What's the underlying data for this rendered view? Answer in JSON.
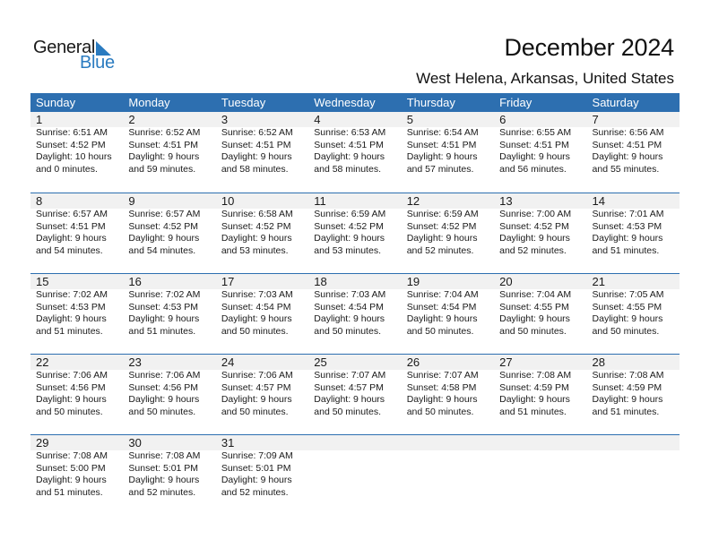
{
  "logo": {
    "word1": "General",
    "word2": "Blue",
    "accent": "#2a7bc0"
  },
  "header": {
    "title": "December 2024",
    "location": "West Helena, Arkansas, United States"
  },
  "colors": {
    "header_bg": "#2d6fb0",
    "strip_bg": "#f1f1f1"
  },
  "weekdays": [
    "Sunday",
    "Monday",
    "Tuesday",
    "Wednesday",
    "Thursday",
    "Friday",
    "Saturday"
  ],
  "weeks": [
    [
      {
        "day": "1",
        "sunrise": "Sunrise: 6:51 AM",
        "sunset": "Sunset: 4:52 PM",
        "daylight1": "Daylight: 10 hours",
        "daylight2": "and 0 minutes."
      },
      {
        "day": "2",
        "sunrise": "Sunrise: 6:52 AM",
        "sunset": "Sunset: 4:51 PM",
        "daylight1": "Daylight: 9 hours",
        "daylight2": "and 59 minutes."
      },
      {
        "day": "3",
        "sunrise": "Sunrise: 6:52 AM",
        "sunset": "Sunset: 4:51 PM",
        "daylight1": "Daylight: 9 hours",
        "daylight2": "and 58 minutes."
      },
      {
        "day": "4",
        "sunrise": "Sunrise: 6:53 AM",
        "sunset": "Sunset: 4:51 PM",
        "daylight1": "Daylight: 9 hours",
        "daylight2": "and 58 minutes."
      },
      {
        "day": "5",
        "sunrise": "Sunrise: 6:54 AM",
        "sunset": "Sunset: 4:51 PM",
        "daylight1": "Daylight: 9 hours",
        "daylight2": "and 57 minutes."
      },
      {
        "day": "6",
        "sunrise": "Sunrise: 6:55 AM",
        "sunset": "Sunset: 4:51 PM",
        "daylight1": "Daylight: 9 hours",
        "daylight2": "and 56 minutes."
      },
      {
        "day": "7",
        "sunrise": "Sunrise: 6:56 AM",
        "sunset": "Sunset: 4:51 PM",
        "daylight1": "Daylight: 9 hours",
        "daylight2": "and 55 minutes."
      }
    ],
    [
      {
        "day": "8",
        "sunrise": "Sunrise: 6:57 AM",
        "sunset": "Sunset: 4:51 PM",
        "daylight1": "Daylight: 9 hours",
        "daylight2": "and 54 minutes."
      },
      {
        "day": "9",
        "sunrise": "Sunrise: 6:57 AM",
        "sunset": "Sunset: 4:52 PM",
        "daylight1": "Daylight: 9 hours",
        "daylight2": "and 54 minutes."
      },
      {
        "day": "10",
        "sunrise": "Sunrise: 6:58 AM",
        "sunset": "Sunset: 4:52 PM",
        "daylight1": "Daylight: 9 hours",
        "daylight2": "and 53 minutes."
      },
      {
        "day": "11",
        "sunrise": "Sunrise: 6:59 AM",
        "sunset": "Sunset: 4:52 PM",
        "daylight1": "Daylight: 9 hours",
        "daylight2": "and 53 minutes."
      },
      {
        "day": "12",
        "sunrise": "Sunrise: 6:59 AM",
        "sunset": "Sunset: 4:52 PM",
        "daylight1": "Daylight: 9 hours",
        "daylight2": "and 52 minutes."
      },
      {
        "day": "13",
        "sunrise": "Sunrise: 7:00 AM",
        "sunset": "Sunset: 4:52 PM",
        "daylight1": "Daylight: 9 hours",
        "daylight2": "and 52 minutes."
      },
      {
        "day": "14",
        "sunrise": "Sunrise: 7:01 AM",
        "sunset": "Sunset: 4:53 PM",
        "daylight1": "Daylight: 9 hours",
        "daylight2": "and 51 minutes."
      }
    ],
    [
      {
        "day": "15",
        "sunrise": "Sunrise: 7:02 AM",
        "sunset": "Sunset: 4:53 PM",
        "daylight1": "Daylight: 9 hours",
        "daylight2": "and 51 minutes."
      },
      {
        "day": "16",
        "sunrise": "Sunrise: 7:02 AM",
        "sunset": "Sunset: 4:53 PM",
        "daylight1": "Daylight: 9 hours",
        "daylight2": "and 51 minutes."
      },
      {
        "day": "17",
        "sunrise": "Sunrise: 7:03 AM",
        "sunset": "Sunset: 4:54 PM",
        "daylight1": "Daylight: 9 hours",
        "daylight2": "and 50 minutes."
      },
      {
        "day": "18",
        "sunrise": "Sunrise: 7:03 AM",
        "sunset": "Sunset: 4:54 PM",
        "daylight1": "Daylight: 9 hours",
        "daylight2": "and 50 minutes."
      },
      {
        "day": "19",
        "sunrise": "Sunrise: 7:04 AM",
        "sunset": "Sunset: 4:54 PM",
        "daylight1": "Daylight: 9 hours",
        "daylight2": "and 50 minutes."
      },
      {
        "day": "20",
        "sunrise": "Sunrise: 7:04 AM",
        "sunset": "Sunset: 4:55 PM",
        "daylight1": "Daylight: 9 hours",
        "daylight2": "and 50 minutes."
      },
      {
        "day": "21",
        "sunrise": "Sunrise: 7:05 AM",
        "sunset": "Sunset: 4:55 PM",
        "daylight1": "Daylight: 9 hours",
        "daylight2": "and 50 minutes."
      }
    ],
    [
      {
        "day": "22",
        "sunrise": "Sunrise: 7:06 AM",
        "sunset": "Sunset: 4:56 PM",
        "daylight1": "Daylight: 9 hours",
        "daylight2": "and 50 minutes."
      },
      {
        "day": "23",
        "sunrise": "Sunrise: 7:06 AM",
        "sunset": "Sunset: 4:56 PM",
        "daylight1": "Daylight: 9 hours",
        "daylight2": "and 50 minutes."
      },
      {
        "day": "24",
        "sunrise": "Sunrise: 7:06 AM",
        "sunset": "Sunset: 4:57 PM",
        "daylight1": "Daylight: 9 hours",
        "daylight2": "and 50 minutes."
      },
      {
        "day": "25",
        "sunrise": "Sunrise: 7:07 AM",
        "sunset": "Sunset: 4:57 PM",
        "daylight1": "Daylight: 9 hours",
        "daylight2": "and 50 minutes."
      },
      {
        "day": "26",
        "sunrise": "Sunrise: 7:07 AM",
        "sunset": "Sunset: 4:58 PM",
        "daylight1": "Daylight: 9 hours",
        "daylight2": "and 50 minutes."
      },
      {
        "day": "27",
        "sunrise": "Sunrise: 7:08 AM",
        "sunset": "Sunset: 4:59 PM",
        "daylight1": "Daylight: 9 hours",
        "daylight2": "and 51 minutes."
      },
      {
        "day": "28",
        "sunrise": "Sunrise: 7:08 AM",
        "sunset": "Sunset: 4:59 PM",
        "daylight1": "Daylight: 9 hours",
        "daylight2": "and 51 minutes."
      }
    ],
    [
      {
        "day": "29",
        "sunrise": "Sunrise: 7:08 AM",
        "sunset": "Sunset: 5:00 PM",
        "daylight1": "Daylight: 9 hours",
        "daylight2": "and 51 minutes."
      },
      {
        "day": "30",
        "sunrise": "Sunrise: 7:08 AM",
        "sunset": "Sunset: 5:01 PM",
        "daylight1": "Daylight: 9 hours",
        "daylight2": "and 52 minutes."
      },
      {
        "day": "31",
        "sunrise": "Sunrise: 7:09 AM",
        "sunset": "Sunset: 5:01 PM",
        "daylight1": "Daylight: 9 hours",
        "daylight2": "and 52 minutes."
      },
      {
        "day": "",
        "sunrise": "",
        "sunset": "",
        "daylight1": "",
        "daylight2": ""
      },
      {
        "day": "",
        "sunrise": "",
        "sunset": "",
        "daylight1": "",
        "daylight2": ""
      },
      {
        "day": "",
        "sunrise": "",
        "sunset": "",
        "daylight1": "",
        "daylight2": ""
      },
      {
        "day": "",
        "sunrise": "",
        "sunset": "",
        "daylight1": "",
        "daylight2": ""
      }
    ]
  ]
}
